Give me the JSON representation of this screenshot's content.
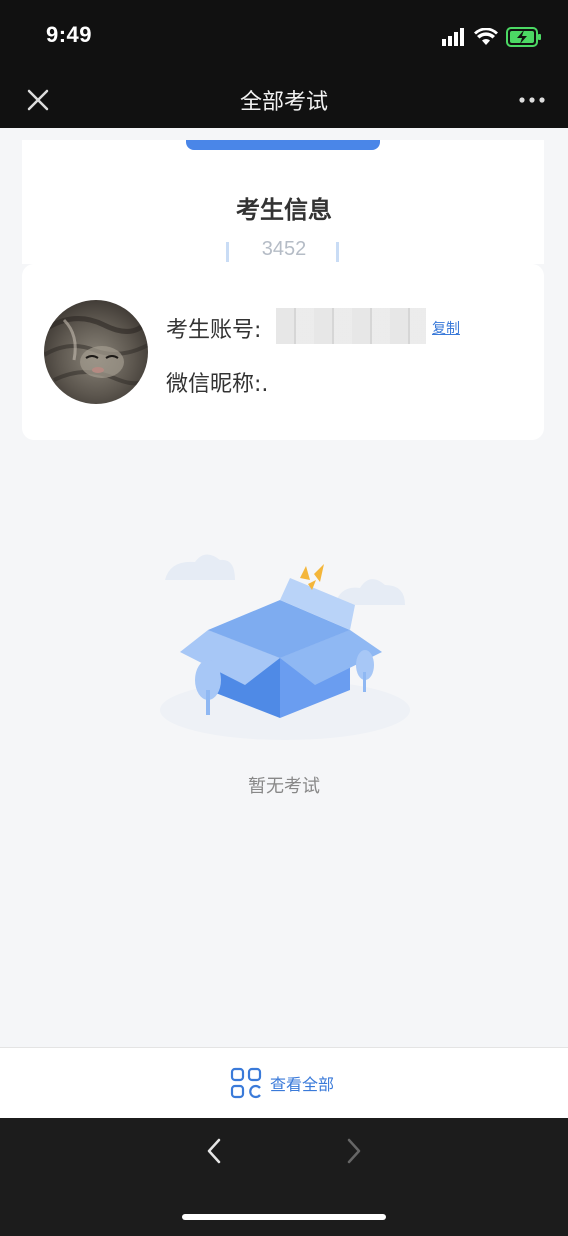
{
  "status_bar": {
    "time": "9:49"
  },
  "navbar": {
    "title": "全部考试",
    "close_icon": "close-icon",
    "more_icon": "more-icon"
  },
  "card": {
    "title": "考生信息",
    "number": "3452"
  },
  "profile": {
    "account_label": "考生账号:",
    "copy_label": "复制",
    "wechat_label": "微信昵称:."
  },
  "empty_state": {
    "text": "暂无考试"
  },
  "bottom": {
    "view_all_label": "查看全部",
    "icon": "grid-icon"
  },
  "colors": {
    "accent": "#4a86e8",
    "link": "#3a7ad9"
  }
}
